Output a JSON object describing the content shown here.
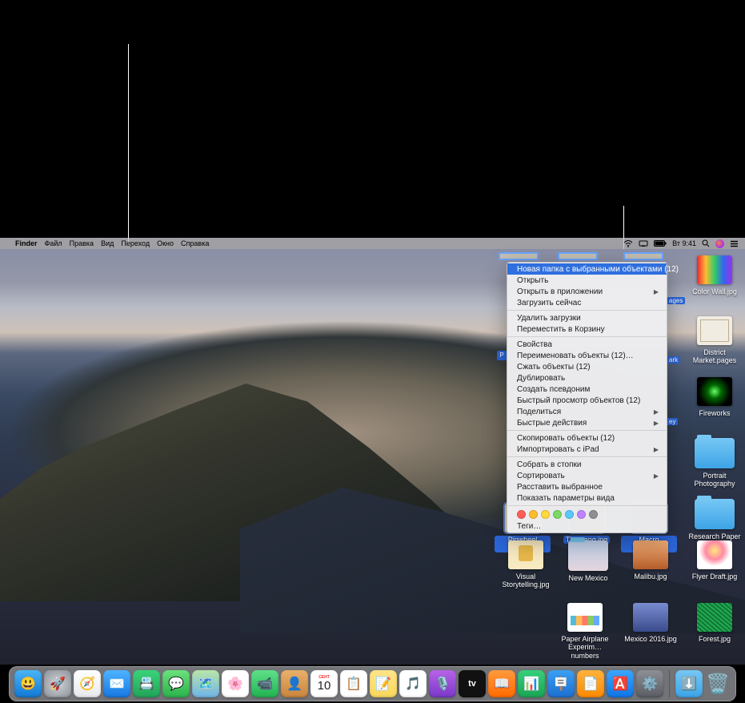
{
  "menubar": {
    "app": "Finder",
    "menus": [
      "Файл",
      "Правка",
      "Вид",
      "Переход",
      "Окно",
      "Справка"
    ],
    "clock": "Вт 9:41"
  },
  "context_menu": {
    "highlighted": "Новая папка с выбранными объектами (12)",
    "groups": [
      [
        "Открыть",
        {
          "label": "Открыть в приложении",
          "sub": true
        },
        "Загрузить сейчас"
      ],
      [
        "Удалить загрузки",
        "Переместить в Корзину"
      ],
      [
        "Свойства",
        "Переименовать объекты (12)…",
        "Сжать объекты (12)",
        "Дублировать",
        "Создать псевдоним",
        "Быстрый просмотр объектов (12)",
        {
          "label": "Поделиться",
          "sub": true
        },
        {
          "label": "Быстрые действия",
          "sub": true
        }
      ],
      [
        "Скопировать объекты (12)",
        {
          "label": "Импортировать с iPad",
          "sub": true
        }
      ],
      [
        "Собрать в стопки",
        {
          "label": "Сортировать",
          "sub": true
        },
        "Расставить выбранное",
        "Показать параметры вида"
      ]
    ],
    "tags_label": "Теги…",
    "tag_colors": [
      "#ff5f57",
      "#ffbd2e",
      "#ffd93b",
      "#7bd964",
      "#5ac8fa",
      "#c183ff",
      "#8e8e93"
    ]
  },
  "desktop_icons": {
    "right_col": [
      {
        "label": "Color Wall.jpg",
        "cls": "colorwall"
      },
      {
        "label": "District Market.pages",
        "cls": "district"
      },
      {
        "label": "Fireworks",
        "cls": "fireworks"
      },
      {
        "label": "Portrait Photography",
        "folder": true
      },
      {
        "label": "Research Paper",
        "folder": true
      }
    ],
    "sel_under": [
      {
        "label": "Pinwheel Idea.jpg"
      },
      {
        "label": "The gang.jpg"
      },
      {
        "label": "Macro Flower.jpg"
      }
    ],
    "row2": [
      {
        "label": "Visual Storytelling.jpg",
        "cls": "visual"
      },
      {
        "label": "New Mexico",
        "cls": "newmex",
        "folder": true
      },
      {
        "label": "Malibu.jpg",
        "cls": "malibu"
      },
      {
        "label": "Flyer Draft.jpg",
        "cls": "flyer"
      }
    ],
    "row3": [
      {
        "label": "Paper Airplane Experim…numbers",
        "cls": "paper"
      },
      {
        "label": "Mexico 2016.jpg",
        "cls": "mexico"
      },
      {
        "label": "Forest.jpg",
        "cls": "forest"
      }
    ],
    "sel_tags": {
      "pages_badge": "ages",
      "park_badge": "ark",
      "pey_badge": "ey"
    }
  },
  "dock": [
    {
      "name": "Finder",
      "bg": "linear-gradient(#4ab4f7,#1278d4)",
      "glyph": "😃"
    },
    {
      "name": "Launchpad",
      "bg": "radial-gradient(circle,#d0d3d8,#8b8f98)",
      "glyph": "🚀"
    },
    {
      "name": "Safari",
      "bg": "linear-gradient(#fff,#e7e9ec)",
      "glyph": "🧭"
    },
    {
      "name": "Mail",
      "bg": "linear-gradient(#4db3ff,#1877e3)",
      "glyph": "✉️"
    },
    {
      "name": "Contacts-like",
      "bg": "linear-gradient(#3ad37a,#1fa558)",
      "glyph": "📇"
    },
    {
      "name": "Messages",
      "bg": "linear-gradient(#6be17d,#2bb24c)",
      "glyph": "💬"
    },
    {
      "name": "Maps",
      "bg": "linear-gradient(#b9e6a8,#6fb4e8)",
      "glyph": "🗺️"
    },
    {
      "name": "Photos",
      "bg": "#fff",
      "glyph": "🌸"
    },
    {
      "name": "FaceTime",
      "bg": "linear-gradient(#5fe08a,#21b351)",
      "glyph": "📹"
    },
    {
      "name": "Contacts",
      "bg": "linear-gradient(#e9b06a,#c9853d)",
      "glyph": "👤"
    },
    {
      "name": "Calendar",
      "bg": "#fff",
      "glyph": "📅"
    },
    {
      "name": "Reminders",
      "bg": "#fff",
      "glyph": "📋"
    },
    {
      "name": "Notes",
      "bg": "linear-gradient(#ffe48a,#f8d85a)",
      "glyph": "📝"
    },
    {
      "name": "Music",
      "bg": "#fff",
      "glyph": "🎵"
    },
    {
      "name": "Podcasts",
      "bg": "linear-gradient(#b862e8,#7a38c7)",
      "glyph": "🎙️"
    },
    {
      "name": "TV",
      "bg": "#111",
      "glyph": "tv"
    },
    {
      "name": "Books",
      "bg": "linear-gradient(#ff9a3c,#ff6a00)",
      "glyph": "📖"
    },
    {
      "name": "Numbers",
      "bg": "linear-gradient(#36d07a,#1aa554)",
      "glyph": "📊"
    },
    {
      "name": "Keynote",
      "bg": "linear-gradient(#3aa0f2,#1d6fd1)",
      "glyph": "🪧"
    },
    {
      "name": "Pages",
      "bg": "linear-gradient(#ffb23c,#ff8a00)",
      "glyph": "📄"
    },
    {
      "name": "AppStore",
      "bg": "linear-gradient(#39a6ff,#1074e6)",
      "glyph": "🅰️"
    },
    {
      "name": "Preferences",
      "bg": "linear-gradient(#8d9096,#5a5d63)",
      "glyph": "⚙️"
    }
  ],
  "dock_right": [
    {
      "name": "Downloads",
      "bg": "linear-gradient(#76c7f4,#3da4e6)",
      "glyph": "⬇️"
    },
    {
      "name": "Trash",
      "bg": "transparent",
      "glyph": "🗑️"
    }
  ],
  "calendar_day": "10",
  "calendar_mon": "СЕНТ"
}
